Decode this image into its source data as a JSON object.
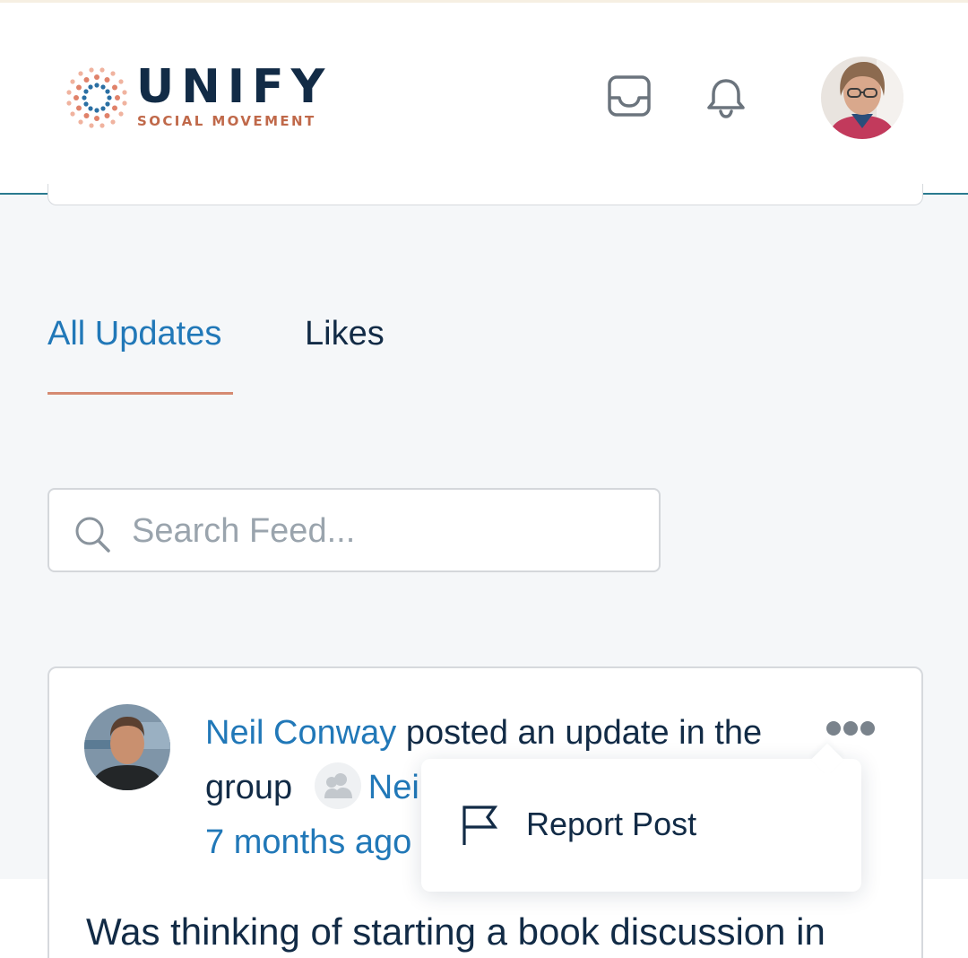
{
  "brand": {
    "name": "UNIFY",
    "tagline": "SOCIAL MOVEMENT",
    "colors": {
      "navy": "#122b46",
      "accent": "#c0694a",
      "teal": "#2a7a8f",
      "link": "#2178b8"
    }
  },
  "header": {
    "icons": [
      "inbox-icon",
      "bell-icon"
    ],
    "avatar": "user-avatar"
  },
  "tabs": [
    {
      "label": "All Updates",
      "active": true
    },
    {
      "label": "Likes",
      "active": false
    }
  ],
  "search": {
    "placeholder": "Search Feed...",
    "value": ""
  },
  "post": {
    "author": "Neil Conway",
    "action": " posted an update in the group ",
    "group_name": "Nei",
    "time": "7 months ago",
    "text": "Was thinking of starting a book discussion in"
  },
  "dropdown": {
    "items": [
      {
        "label": "Report Post",
        "icon": "flag-icon"
      }
    ]
  }
}
